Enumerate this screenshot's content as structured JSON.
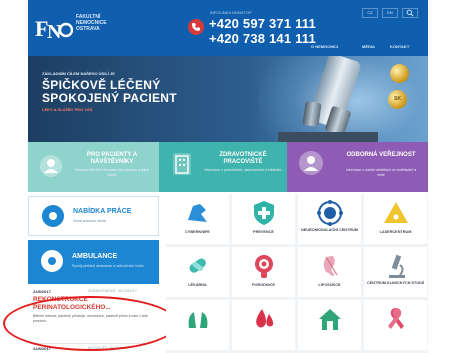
{
  "header": {
    "logo_short": "FNO",
    "logo_lines": [
      "FAKULTNÍ",
      "NEMOCNICE",
      "OSTRAVA"
    ],
    "contact_label": "INFOLINKA NONSTOP",
    "phone_primary": "+420 597 371 111",
    "phone_secondary": "+420 738 141 111",
    "lang_buttons": [
      "CZ",
      "EN",
      "Q"
    ],
    "nav": [
      "O NEMOCNICI",
      "MÉDIA",
      "KONTAKT"
    ],
    "colors": {
      "brand_blue": "#0f5fae",
      "phone_red": "#d63a3a"
    }
  },
  "hero": {
    "kicker": "ZÁKLADNÍM CÍLEM NAŠEHO ÚSILÍ JE",
    "line1": "ŠPIČKOVĚ LÉČENÝ",
    "line2": "SPOKOJENÝ PACIENT",
    "cta": "LÉKY A SLUŽBY PRO VÁS",
    "seal2_text": "SK"
  },
  "bands": [
    {
      "title": "PRO PACIENTY A NÁVŠTĚVNÍKY",
      "subtitle": "Veškeré důležité informace pro pacienty a jejich blízké",
      "color": "#8fd3cd",
      "icon": "user-icon"
    },
    {
      "title": "ZDRAVOTNICKÉ PRACOVIŠTĚ",
      "subtitle": "Informace o pracovištích, ambulancích a klinikách",
      "color": "#3fb3ad",
      "icon": "building-icon"
    },
    {
      "title": "ODBORNÁ VEŘEJNOST",
      "subtitle": "Informace o našich aktivitách ve vzdělávání a vědě",
      "color": "#8e5cb4",
      "icon": "person-icon"
    }
  ],
  "left": {
    "prace_title": "NABÍDKA PRÁCE",
    "prace_sub": "Volná pracovní místa",
    "amb_title": "AMBULANCE",
    "amb_sub": "Rychlý přehled ambulancí a ordinačních hodin"
  },
  "news": [
    {
      "date": "22/8/2017",
      "tag": "ZDRAVOTNICKÉ  ·  AKTUALITY",
      "title_line1": "REKONSTRUKCE",
      "title_line2": "PERINATOLOGICKÉHO...",
      "text": "Během měsíce, pacienti, přístroje, nemocnice, pacienti přímo k nám v dně prostoru..."
    },
    {
      "date": "22/8/2017",
      "tag": "AKTUALITY  ·  AKTUALITY",
      "title_line1": "",
      "title_line2": "",
      "text": ""
    }
  ],
  "tiles": [
    {
      "label": "CYBERKNIFE",
      "icon": "cyberknife-icon"
    },
    {
      "label": "PREVENCE",
      "icon": "shield-plus-icon"
    },
    {
      "label": "NEUROMODULAČNÍ CENTRUM",
      "icon": "brain-icon"
    },
    {
      "label": "LASERCENTRUM",
      "icon": "warning-triangle-icon"
    },
    {
      "label": "LÉKÁRNA",
      "icon": "pills-icon"
    },
    {
      "label": "PORODNICE",
      "icon": "baby-icon"
    },
    {
      "label": "LIPOSUKCE",
      "icon": "ear-icon"
    },
    {
      "label": "CENTRUM KLINICKÝCH STUDIÍ",
      "icon": "microscope-icon"
    },
    {
      "label": "",
      "icon": "lungs-icon"
    },
    {
      "label": "",
      "icon": "blood-drop-icon"
    },
    {
      "label": "",
      "icon": "home-icon"
    },
    {
      "label": "",
      "icon": "ribbon-icon"
    }
  ]
}
